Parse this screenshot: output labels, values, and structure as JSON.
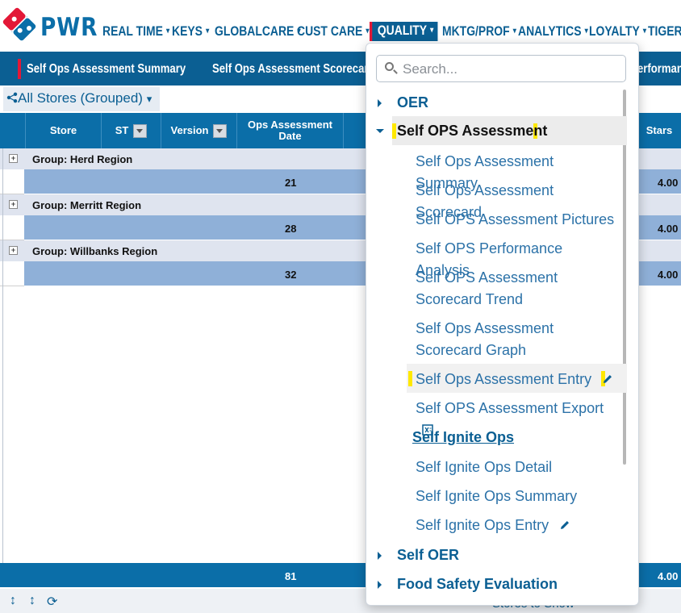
{
  "app": {
    "brand": "PWR",
    "nav": [
      {
        "label": "REAL TIME"
      },
      {
        "label": "KEYS"
      },
      {
        "label": "GLOBALCARE"
      },
      {
        "label": "CUST CARE"
      },
      {
        "label": "QUALITY"
      },
      {
        "label": "MKTG/PROF"
      },
      {
        "label": "ANALYTICS"
      },
      {
        "label": "LOYALTY"
      },
      {
        "label": "TIGER"
      }
    ],
    "nav_caret": "▾"
  },
  "tabs": [
    {
      "label": "Self Ops Assessment Summary"
    },
    {
      "label": "Self Ops Assessment Scorecard"
    },
    {
      "label": "erforman"
    }
  ],
  "stores_selector": {
    "label": "All Stores (Grouped)",
    "caret": "▾"
  },
  "table": {
    "columns": [
      {
        "label": "Store"
      },
      {
        "label": "ST"
      },
      {
        "label": "Version"
      },
      {
        "label": "Ops Assessment Date"
      },
      {
        "label": "Stars"
      }
    ],
    "groups": [
      {
        "label": "Group: Herd Region",
        "count": "21",
        "stars": "4.00"
      },
      {
        "label": "Group: Merritt Region",
        "count": "28",
        "stars": "4.00"
      },
      {
        "label": "Group: Willbanks Region",
        "count": "32",
        "stars": "4.00"
      }
    ],
    "footer": {
      "count": "81",
      "stars": "4.00"
    },
    "expand_glyph": "+"
  },
  "bottom_text": "Stores to Show",
  "dropdown": {
    "search_placeholder": "Search...",
    "sections": [
      {
        "label": "OER"
      },
      {
        "label": "Self OPS Assessment"
      },
      {
        "label": "Self OER"
      },
      {
        "label": "Food Safety Evaluation"
      }
    ],
    "items": [
      {
        "label": "Self Ops Assessment Summary"
      },
      {
        "label": "Self Ops Assessment Scorecard"
      },
      {
        "label": "Self OPS Assessment Pictures"
      },
      {
        "label": "Self OPS Performance Analysis"
      },
      {
        "label": "Self OPS Assessment Scorecard Trend"
      },
      {
        "label": "Self Ops Assessment Scorecard Graph"
      },
      {
        "label": "Self Ops Assessment Entry"
      },
      {
        "label": "Self OPS Assessment Export"
      }
    ],
    "subheading": "Self Ignite Ops",
    "ignite_items": [
      {
        "label": "Self Ignite Ops Detail"
      },
      {
        "label": "Self Ignite Ops Summary"
      },
      {
        "label": "Self Ignite Ops Entry"
      }
    ]
  },
  "colors": {
    "primary": "#0b5f93",
    "accent_red": "#e31837",
    "highlight": "#ffe800",
    "row_blue": "#8fb0d8"
  }
}
